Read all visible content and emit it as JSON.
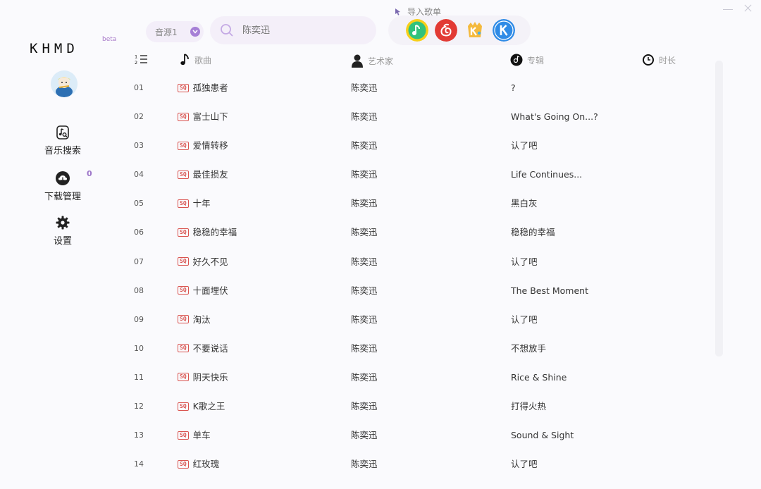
{
  "app": {
    "logo": "KHMD",
    "beta": "beta"
  },
  "sidebar": {
    "items": [
      {
        "label": "音乐搜索",
        "icon": "music-search-icon"
      },
      {
        "label": "下载管理",
        "icon": "cloud-download-icon"
      },
      {
        "label": "设置",
        "icon": "gear-icon"
      }
    ],
    "download_count": "0"
  },
  "topbar": {
    "source": {
      "value": "音源1"
    },
    "search": {
      "placeholder": "陈奕迅"
    },
    "import_label": "导入歌单",
    "platforms": [
      {
        "name": "qq-music-icon",
        "color": "#f7cf19"
      },
      {
        "name": "netease-music-icon",
        "color": "#e23a34"
      },
      {
        "name": "kuwo-music-icon",
        "color": "#f4b93c"
      },
      {
        "name": "kugou-music-icon",
        "color": "#2f8be6"
      }
    ]
  },
  "table": {
    "headers": {
      "song": "歌曲",
      "artist": "艺术家",
      "album": "专辑",
      "duration": "时长"
    },
    "quality_badge": "SQ",
    "rows": [
      {
        "idx": "01",
        "song": "孤独患者",
        "artist": "陈奕迅",
        "album": "?"
      },
      {
        "idx": "02",
        "song": "富士山下",
        "artist": "陈奕迅",
        "album": "What's Going On...?"
      },
      {
        "idx": "03",
        "song": "爱情转移",
        "artist": "陈奕迅",
        "album": "认了吧"
      },
      {
        "idx": "04",
        "song": "最佳损友",
        "artist": "陈奕迅",
        "album": "Life Continues..."
      },
      {
        "idx": "05",
        "song": "十年",
        "artist": "陈奕迅",
        "album": "黑白灰"
      },
      {
        "idx": "06",
        "song": "稳稳的幸福",
        "artist": "陈奕迅",
        "album": "稳稳的幸福"
      },
      {
        "idx": "07",
        "song": "好久不见",
        "artist": "陈奕迅",
        "album": "认了吧"
      },
      {
        "idx": "08",
        "song": "十面埋伏",
        "artist": "陈奕迅",
        "album": "The Best Moment"
      },
      {
        "idx": "09",
        "song": "淘汰",
        "artist": "陈奕迅",
        "album": "认了吧"
      },
      {
        "idx": "10",
        "song": "不要说话",
        "artist": "陈奕迅",
        "album": "不想放手"
      },
      {
        "idx": "11",
        "song": "阴天快乐",
        "artist": "陈奕迅",
        "album": "Rice & Shine"
      },
      {
        "idx": "12",
        "song": "K歌之王",
        "artist": "陈奕迅",
        "album": "打得火热"
      },
      {
        "idx": "13",
        "song": "单车",
        "artist": "陈奕迅",
        "album": "Sound & Sight"
      },
      {
        "idx": "14",
        "song": "红玫瑰",
        "artist": "陈奕迅",
        "album": "认了吧"
      }
    ]
  },
  "colors": {
    "accent": "#a67fd6",
    "sq_badge": "#d9534f",
    "background": "#fafafd"
  }
}
